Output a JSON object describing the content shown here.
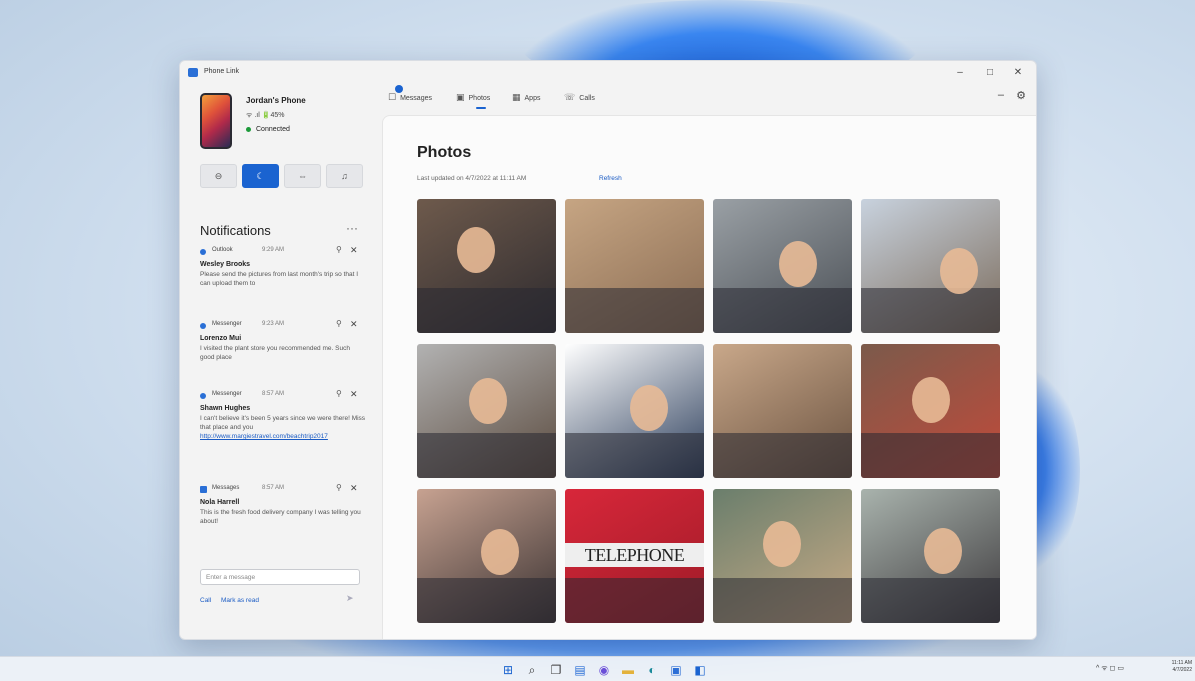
{
  "window": {
    "title": "Phone Link",
    "controls": {
      "minimize": "–",
      "maximize": "□",
      "close": "✕"
    }
  },
  "phone": {
    "name": "Jordan's Phone",
    "status": "ᯤ .ıl 🔋45%",
    "connection": "Connected"
  },
  "quick_actions": [
    {
      "icon": "do-not-disturb-icon",
      "glyph": "⊖"
    },
    {
      "icon": "moon-icon",
      "glyph": "☾"
    },
    {
      "icon": "audio-icon",
      "glyph": "⇔"
    },
    {
      "icon": "music-icon",
      "glyph": "♫"
    }
  ],
  "notifications": {
    "header": "Notifications",
    "more": "···",
    "items": [
      {
        "app": "Outlook",
        "time": "9:29 AM",
        "sender": "Wesley Brooks",
        "body": "Please send the pictures from last month's trip so that I can upload them to",
        "link": ""
      },
      {
        "app": "Messenger",
        "time": "9:23 AM",
        "sender": "Lorenzo Mui",
        "body": "I visited the plant store you recommended me. Such good place",
        "link": ""
      },
      {
        "app": "Messenger",
        "time": "8:57 AM",
        "sender": "Shawn Hughes",
        "body": "I can't believe it's been 5 years since we were there! Miss that place and you",
        "link": "http://www.margiestravel.com/beachtrip2017"
      },
      {
        "app": "Messages",
        "time": "8:57 AM",
        "sender": "Nola Harrell",
        "body": "This is the fresh food delivery company I was telling you about!",
        "link": ""
      }
    ],
    "reply_placeholder": "Enter a message",
    "actions": {
      "call": "Call",
      "mark_read": "Mark as read"
    }
  },
  "tabs": [
    {
      "label": "Messages",
      "icon": "chat-icon",
      "glyph": "☐"
    },
    {
      "label": "Photos",
      "icon": "photos-icon",
      "glyph": "▣"
    },
    {
      "label": "Apps",
      "icon": "apps-icon",
      "glyph": "▦"
    },
    {
      "label": "Calls",
      "icon": "calls-icon",
      "glyph": "☏"
    }
  ],
  "photos_page": {
    "title": "Photos",
    "last_updated": "Last updated on 4/7/2022 at 11:11 AM",
    "refresh": "Refresh"
  },
  "photos": [
    {
      "c1": "#6e5a4c",
      "c2": "#2d2a2e",
      "face": true
    },
    {
      "c1": "#c6a583",
      "c2": "#8a6c53",
      "face": false
    },
    {
      "c1": "#9aa0a5",
      "c2": "#4a4f55",
      "face": true
    },
    {
      "c1": "#c8d2de",
      "c2": "#7b6b5b",
      "face": true
    },
    {
      "c1": "#b2b2b2",
      "c2": "#5b4b3f",
      "face": true
    },
    {
      "c1": "#ffffff",
      "c2": "#2a3c5a",
      "face": true
    },
    {
      "c1": "#c9a88a",
      "c2": "#6a5240",
      "face": false
    },
    {
      "c1": "#7b5a4b",
      "c2": "#c24a3a",
      "face": true
    },
    {
      "c1": "#c7a291",
      "c2": "#3a3232",
      "face": true
    },
    {
      "c1": "#d8273a",
      "c2": "#9e1b27",
      "face": false,
      "text": "TELEPHONE"
    },
    {
      "c1": "#6a7e6c",
      "c2": "#c9ab86",
      "face": true
    },
    {
      "c1": "#a9b3ad",
      "c2": "#3d3a3d",
      "face": true
    }
  ],
  "taskbar": {
    "icons": [
      "windows-icon",
      "search-icon",
      "taskview-icon",
      "widgets-icon",
      "chat-icon",
      "explorer-icon",
      "edge-icon",
      "store-icon",
      "phonelink-icon"
    ],
    "tray": "^ ᯤ ◻ ▭",
    "clock_time": "11:11 AM",
    "clock_date": "4/7/2022"
  }
}
